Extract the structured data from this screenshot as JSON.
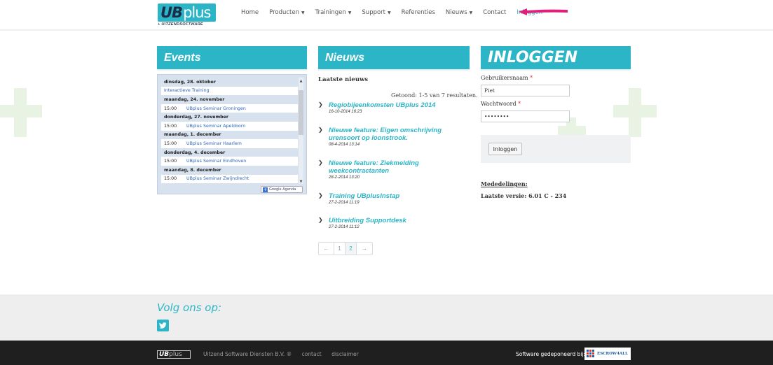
{
  "logo": {
    "brand_ub": "UB",
    "brand_plus": "plus",
    "tagline": "+ UITZENDSOFTWARE"
  },
  "nav": {
    "items": [
      {
        "label": "Home"
      },
      {
        "label": "Producten"
      },
      {
        "label": "Trainingen"
      },
      {
        "label": "Support"
      },
      {
        "label": "Referenties"
      },
      {
        "label": "Nieuws"
      },
      {
        "label": "Contact"
      },
      {
        "label": "Inloggen"
      }
    ]
  },
  "colors": {
    "accent": "#2bb5c6",
    "arrow": "#e0217c",
    "footer": "#1f1f1f"
  },
  "events": {
    "title": "Events",
    "rows": [
      {
        "type": "day",
        "text": "dinsdag, 28. oktober"
      },
      {
        "type": "ev",
        "time": "",
        "text": "Interactieve Training"
      },
      {
        "type": "day",
        "text": "maandag, 24. november"
      },
      {
        "type": "ev",
        "time": "15:00",
        "text": "UBplus Seminar Groningen"
      },
      {
        "type": "day",
        "text": "donderdag, 27. november"
      },
      {
        "type": "ev",
        "time": "15:00",
        "text": "UBplus Seminar Apeldoorn"
      },
      {
        "type": "day",
        "text": "maandag, 1. december"
      },
      {
        "type": "ev",
        "time": "15:00",
        "text": "UBplus Seminar Haarlem"
      },
      {
        "type": "day",
        "text": "donderdag, 4. december"
      },
      {
        "type": "ev",
        "time": "15:00",
        "text": "UBplus Seminar Eindhoven"
      },
      {
        "type": "day",
        "text": "maandag, 8. december"
      },
      {
        "type": "ev",
        "time": "15:00",
        "text": "UBplus Seminar Zwijndrecht"
      }
    ],
    "google_agenda": "Google Agenda"
  },
  "news": {
    "title": "Nieuws",
    "subtitle": "Laatste nieuws",
    "count": "Getoond: 1-5 van 7 resultaten.",
    "items": [
      {
        "title": "Regiobijeenkomsten UBplus 2014",
        "date": "16-10-2014 16:23"
      },
      {
        "title": "Nieuwe feature: Eigen omschrijving urensoort op loonstrook.",
        "date": "08-4-2014 13:14"
      },
      {
        "title": "Nieuwe feature: Ziekmelding weekcontractanten",
        "date": "28-2-2014 13:20"
      },
      {
        "title": "Training UBplusInstap",
        "date": "27-2-2014 11:19"
      },
      {
        "title": "Uitbreiding Supportdesk",
        "date": "27-2-2014 11:12"
      }
    ],
    "pager": {
      "prev": "←",
      "p1": "1",
      "p2": "2",
      "next": "→"
    }
  },
  "login": {
    "title": "INLOGGEN",
    "user_label": "Gebruikersnaam",
    "user_value": "Piet",
    "pass_label": "Wachtwoord",
    "pass_value": "••••••••",
    "required_mark": "*",
    "button": "Inloggen",
    "meded": "Mededelingen:",
    "versie": "Laatste versie: 6.01 C - 234"
  },
  "follow": {
    "title": "Volg ons op:"
  },
  "footer": {
    "logo_ub": "UB",
    "logo_plus": "plus",
    "company": "Uitzend Software Diensten B.V. ®",
    "contact": "contact",
    "disclaimer": "disclaimer",
    "escrow_text": "Software gedeponeerd bij:",
    "escrow_brand": "ESCROW4ALL"
  }
}
